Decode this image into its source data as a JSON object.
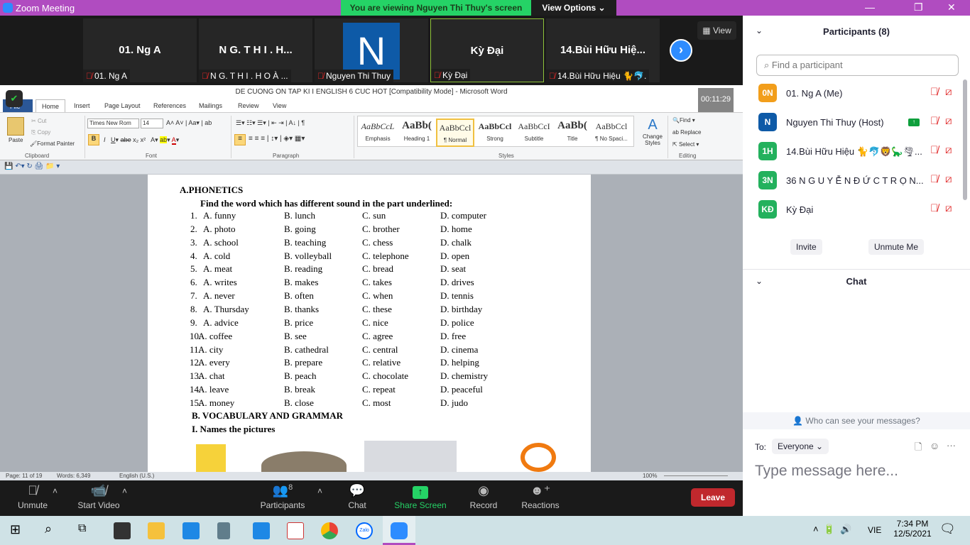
{
  "window": {
    "title": "Zoom Meeting",
    "viewing_banner": "You are viewing Nguyen Thi Thuy's screen",
    "view_options": "View Options"
  },
  "gallery": {
    "tiles": [
      {
        "big": "01. Ng A",
        "label": "01. Ng A"
      },
      {
        "big": "N G.  T H I .  H...",
        "label": "N G.  T H I .  H O À ..."
      },
      {
        "big": "N",
        "label": "Nguyen Thi Thuy"
      },
      {
        "big": "Kỳ Đại",
        "label": "Kỳ Đại"
      },
      {
        "big": "14.Bùi Hữu Hiệ...",
        "label": "14.Bùi Hữu Hiệu 🐈🐬."
      }
    ],
    "view_label": "View"
  },
  "word": {
    "title": "DE CUONG ON TAP KI I ENGLISH 6 CUC HOT [Compatibility Mode] - Microsoft Word",
    "timer": "00:11:29",
    "tabs": [
      "File",
      "Home",
      "Insert",
      "Page Layout",
      "References",
      "Mailings",
      "Review",
      "View"
    ],
    "clipboard": {
      "paste": "Paste",
      "cut": "Cut",
      "copy": "Copy",
      "format_painter": "Format Painter",
      "group": "Clipboard"
    },
    "font": {
      "name": "Times New Rom",
      "size": "14",
      "group": "Font"
    },
    "paragraph_group": "Paragraph",
    "styles": [
      {
        "sample": "AaBbCcL",
        "name": "Emphasis"
      },
      {
        "sample": "AaBb(",
        "name": "Heading 1"
      },
      {
        "sample": "AaBbCcl",
        "name": "¶ Normal"
      },
      {
        "sample": "AaBbCcl",
        "name": "Strong"
      },
      {
        "sample": "AaBbCcI",
        "name": "Subtitle"
      },
      {
        "sample": "AaBb(",
        "name": "Title"
      },
      {
        "sample": "AaBbCcl",
        "name": "¶ No Spaci..."
      }
    ],
    "styles_group": "Styles",
    "change_styles": "Change Styles",
    "editing": {
      "find": "Find",
      "replace": "Replace",
      "select": "Select",
      "group": "Editing"
    },
    "status": {
      "page": "Page: 11 of 19",
      "words": "Words: 6,349",
      "language": "English (U.S.)",
      "zoom": "100%"
    }
  },
  "document": {
    "section_a": "A.PHONETICS",
    "instruction": "Find the word which has different sound in the part underlined:",
    "rows": [
      [
        "1.",
        "A. funny",
        "B. lunch",
        "C. sun",
        "D. computer"
      ],
      [
        "2.",
        "A. photo",
        "B. going",
        "C. brother",
        "D. home"
      ],
      [
        "3.",
        "A. school",
        "B. teaching",
        "C. chess",
        "D. chalk"
      ],
      [
        "4.",
        "A. cold",
        "B. volleyball",
        "C. telephone",
        "D. open"
      ],
      [
        "5.",
        "A. meat",
        "B. reading",
        "C. bread",
        "D. seat"
      ],
      [
        "6.",
        "A. writes",
        "B. makes",
        "C. takes",
        "D. drives"
      ],
      [
        "7.",
        "A. never",
        "B. often",
        "C. when",
        "D. tennis"
      ],
      [
        "8.",
        "A. Thursday",
        "B. thanks",
        "C. these",
        "D. birthday"
      ],
      [
        "9.",
        "A. advice",
        "B. price",
        "C. nice",
        "D. police"
      ],
      [
        "10.",
        "A. coffee",
        "B. see",
        "C. agree",
        "D. free"
      ],
      [
        "11.",
        "A. city",
        "B. cathedral",
        "C. central",
        "D. cinema"
      ],
      [
        "12.",
        "A. every",
        "B. prepare",
        "C. relative",
        "D. helping"
      ],
      [
        "13.",
        "A. chat",
        "B. peach",
        "C. chocolate",
        "D. chemistry"
      ],
      [
        "14.",
        "A. leave",
        "B. break",
        "C. repeat",
        "D. peaceful"
      ],
      [
        "15.",
        "A. money",
        "B. close",
        "C. most",
        "D. judo"
      ]
    ],
    "section_b": "B.  VOCABULARY AND GRAMMAR",
    "subsection": "I.   Names the pictures"
  },
  "toolbar": {
    "unmute": "Unmute",
    "start_video": "Start Video",
    "participants": "Participants",
    "participant_count": "8",
    "chat": "Chat",
    "share_screen": "Share Screen",
    "record": "Record",
    "reactions": "Reactions",
    "leave": "Leave"
  },
  "panel": {
    "participants_title": "Participants (8)",
    "search_placeholder": "Find a participant",
    "participants": [
      {
        "initials": "0N",
        "name": "01. Ng A (Me)",
        "color": "#f29e1b"
      },
      {
        "initials": "N",
        "name": "Nguyen Thi Thuy (Host)",
        "color": "#0e5aa7",
        "sharing": true
      },
      {
        "initials": "1H",
        "name": "14.Bùi Hữu Hiệu 🐈🐬🦁🦕🌪...",
        "color": "#23b15d"
      },
      {
        "initials": "3N",
        "name": "36 N G U Y Ễ N Đ Ứ C T R Ọ N...",
        "color": "#23b15d"
      },
      {
        "initials": "KĐ",
        "name": "Kỳ Đại",
        "color": "#23b15d"
      }
    ],
    "invite": "Invite",
    "unmute_me": "Unmute Me",
    "chat_title": "Chat",
    "who_can_see": "Who can see your messages?",
    "to_label": "To:",
    "to_value": "Everyone",
    "message_placeholder": "Type message here..."
  },
  "taskbar": {
    "language": "VIE",
    "time": "7:34 PM",
    "date": "12/5/2021"
  }
}
